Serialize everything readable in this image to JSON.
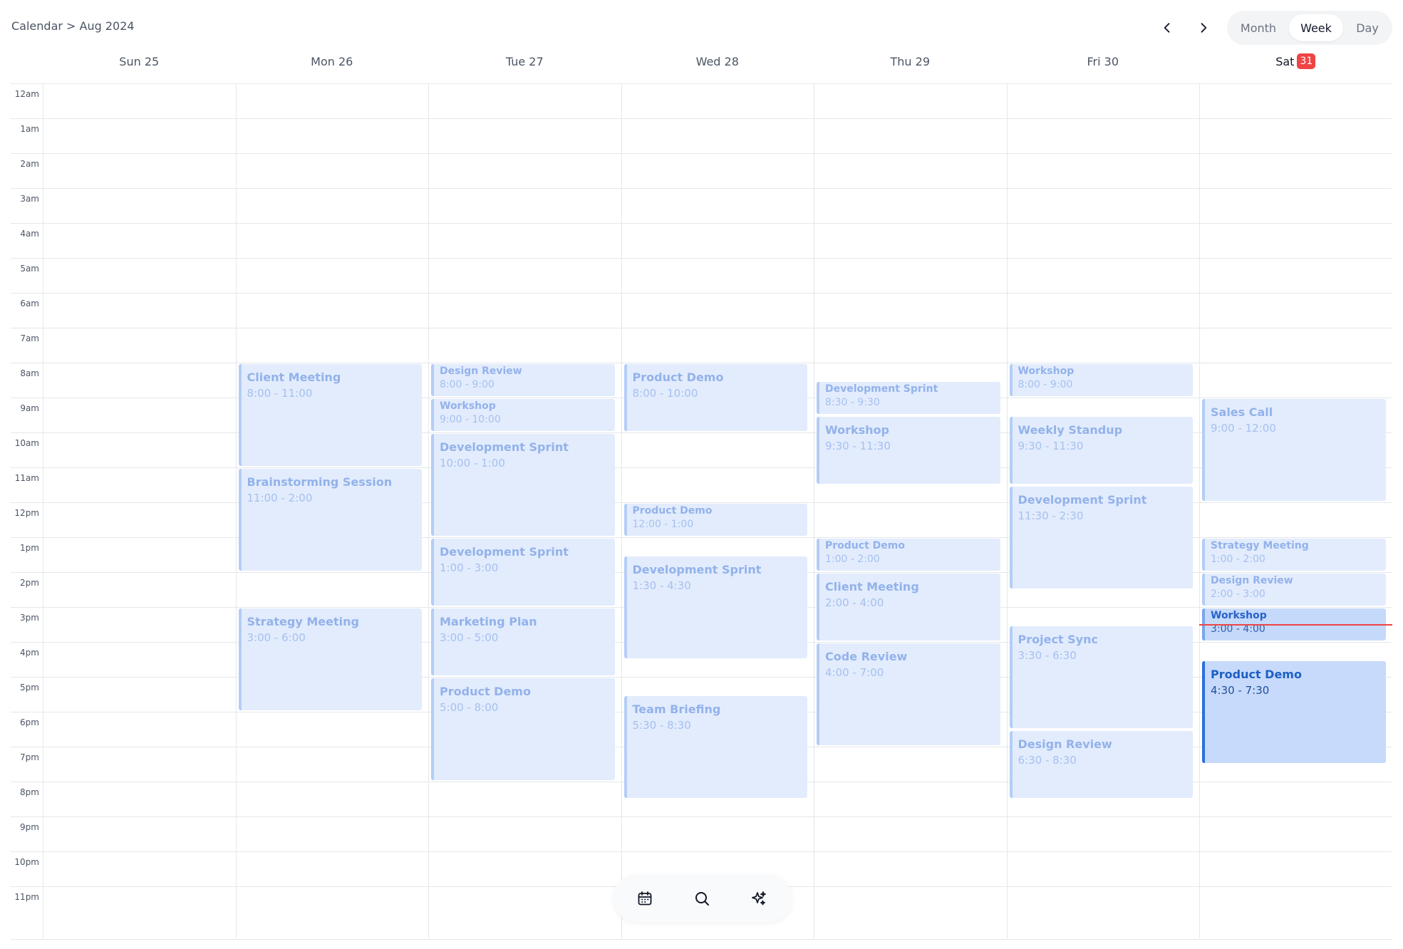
{
  "header": {
    "breadcrumb": "Calendar > Aug 2024",
    "prev_icon": "chevron-left-icon",
    "next_icon": "chevron-right-icon",
    "views": [
      {
        "label": "Month",
        "active": false
      },
      {
        "label": "Week",
        "active": true
      },
      {
        "label": "Day",
        "active": false
      }
    ]
  },
  "days": [
    {
      "label": "Sun 25"
    },
    {
      "label": "Mon 26"
    },
    {
      "label": "Tue 27"
    },
    {
      "label": "Wed 28"
    },
    {
      "label": "Thu 29"
    },
    {
      "label": "Fri 30"
    },
    {
      "label": "Sat",
      "badge": "31",
      "today": true
    }
  ],
  "hours": [
    "12am",
    "1am",
    "2am",
    "3am",
    "4am",
    "5am",
    "6am",
    "7am",
    "8am",
    "9am",
    "10am",
    "11am",
    "12pm",
    "1pm",
    "2pm",
    "3pm",
    "4pm",
    "5pm",
    "6pm",
    "7pm",
    "8pm",
    "9pm",
    "10pm",
    "11pm"
  ],
  "current_time": {
    "day": 6,
    "hour": 15.5
  },
  "events": [
    {
      "day": 1,
      "start": 8,
      "end": 11,
      "title": "Client Meeting",
      "time": "8:00 - 11:00"
    },
    {
      "day": 1,
      "start": 11,
      "end": 14,
      "title": "Brainstorming Session",
      "time": "11:00 - 2:00"
    },
    {
      "day": 1,
      "start": 15,
      "end": 18,
      "title": "Strategy Meeting",
      "time": "3:00 - 6:00"
    },
    {
      "day": 2,
      "start": 8,
      "end": 9,
      "title": "Design Review",
      "time": "8:00 - 9:00"
    },
    {
      "day": 2,
      "start": 9,
      "end": 10,
      "title": "Workshop",
      "time": "9:00 - 10:00"
    },
    {
      "day": 2,
      "start": 10,
      "end": 13,
      "title": "Development Sprint",
      "time": "10:00 - 1:00"
    },
    {
      "day": 2,
      "start": 13,
      "end": 15,
      "title": "Development Sprint",
      "time": "1:00 - 3:00"
    },
    {
      "day": 2,
      "start": 15,
      "end": 17,
      "title": "Marketing Plan",
      "time": "3:00 - 5:00"
    },
    {
      "day": 2,
      "start": 17,
      "end": 20,
      "title": "Product Demo",
      "time": "5:00 - 8:00"
    },
    {
      "day": 3,
      "start": 8,
      "end": 10,
      "title": "Product Demo",
      "time": "8:00 - 10:00"
    },
    {
      "day": 3,
      "start": 12,
      "end": 13,
      "title": "Product Demo",
      "time": "12:00 - 1:00"
    },
    {
      "day": 3,
      "start": 13.5,
      "end": 16.5,
      "title": "Development Sprint",
      "time": "1:30 - 4:30"
    },
    {
      "day": 3,
      "start": 17.5,
      "end": 20.5,
      "title": "Team Briefing",
      "time": "5:30 - 8:30"
    },
    {
      "day": 4,
      "start": 8.5,
      "end": 9.5,
      "title": "Development Sprint",
      "time": "8:30 - 9:30"
    },
    {
      "day": 4,
      "start": 9.5,
      "end": 11.5,
      "title": "Workshop",
      "time": "9:30 - 11:30"
    },
    {
      "day": 4,
      "start": 13,
      "end": 14,
      "title": "Product Demo",
      "time": "1:00 - 2:00"
    },
    {
      "day": 4,
      "start": 14,
      "end": 16,
      "title": "Client Meeting",
      "time": "2:00 - 4:00"
    },
    {
      "day": 4,
      "start": 16,
      "end": 19,
      "title": "Code Review",
      "time": "4:00 - 7:00"
    },
    {
      "day": 5,
      "start": 8,
      "end": 9,
      "title": "Workshop",
      "time": "8:00 - 9:00"
    },
    {
      "day": 5,
      "start": 9.5,
      "end": 11.5,
      "title": "Weekly Standup",
      "time": "9:30 - 11:30"
    },
    {
      "day": 5,
      "start": 11.5,
      "end": 14.5,
      "title": "Development Sprint",
      "time": "11:30 - 2:30"
    },
    {
      "day": 5,
      "start": 15.5,
      "end": 18.5,
      "title": "Project Sync",
      "time": "3:30 - 6:30"
    },
    {
      "day": 5,
      "start": 18.5,
      "end": 20.5,
      "title": "Design Review",
      "time": "6:30 - 8:30"
    },
    {
      "day": 6,
      "start": 9,
      "end": 12,
      "title": "Sales Call",
      "time": "9:00 - 12:00"
    },
    {
      "day": 6,
      "start": 13,
      "end": 14,
      "title": "Strategy Meeting",
      "time": "1:00 - 2:00"
    },
    {
      "day": 6,
      "start": 14,
      "end": 15,
      "title": "Design Review",
      "time": "2:00 - 3:00"
    },
    {
      "day": 6,
      "start": 15,
      "end": 16,
      "title": "Workshop",
      "time": "3:00 - 4:00",
      "state": "current"
    },
    {
      "day": 6,
      "start": 16.5,
      "end": 19.5,
      "title": "Product Demo",
      "time": "4:30 - 7:30",
      "state": "active"
    }
  ],
  "toolbar": [
    {
      "icon": "calendar-icon"
    },
    {
      "icon": "search-icon"
    },
    {
      "icon": "sparkles-icon"
    }
  ]
}
